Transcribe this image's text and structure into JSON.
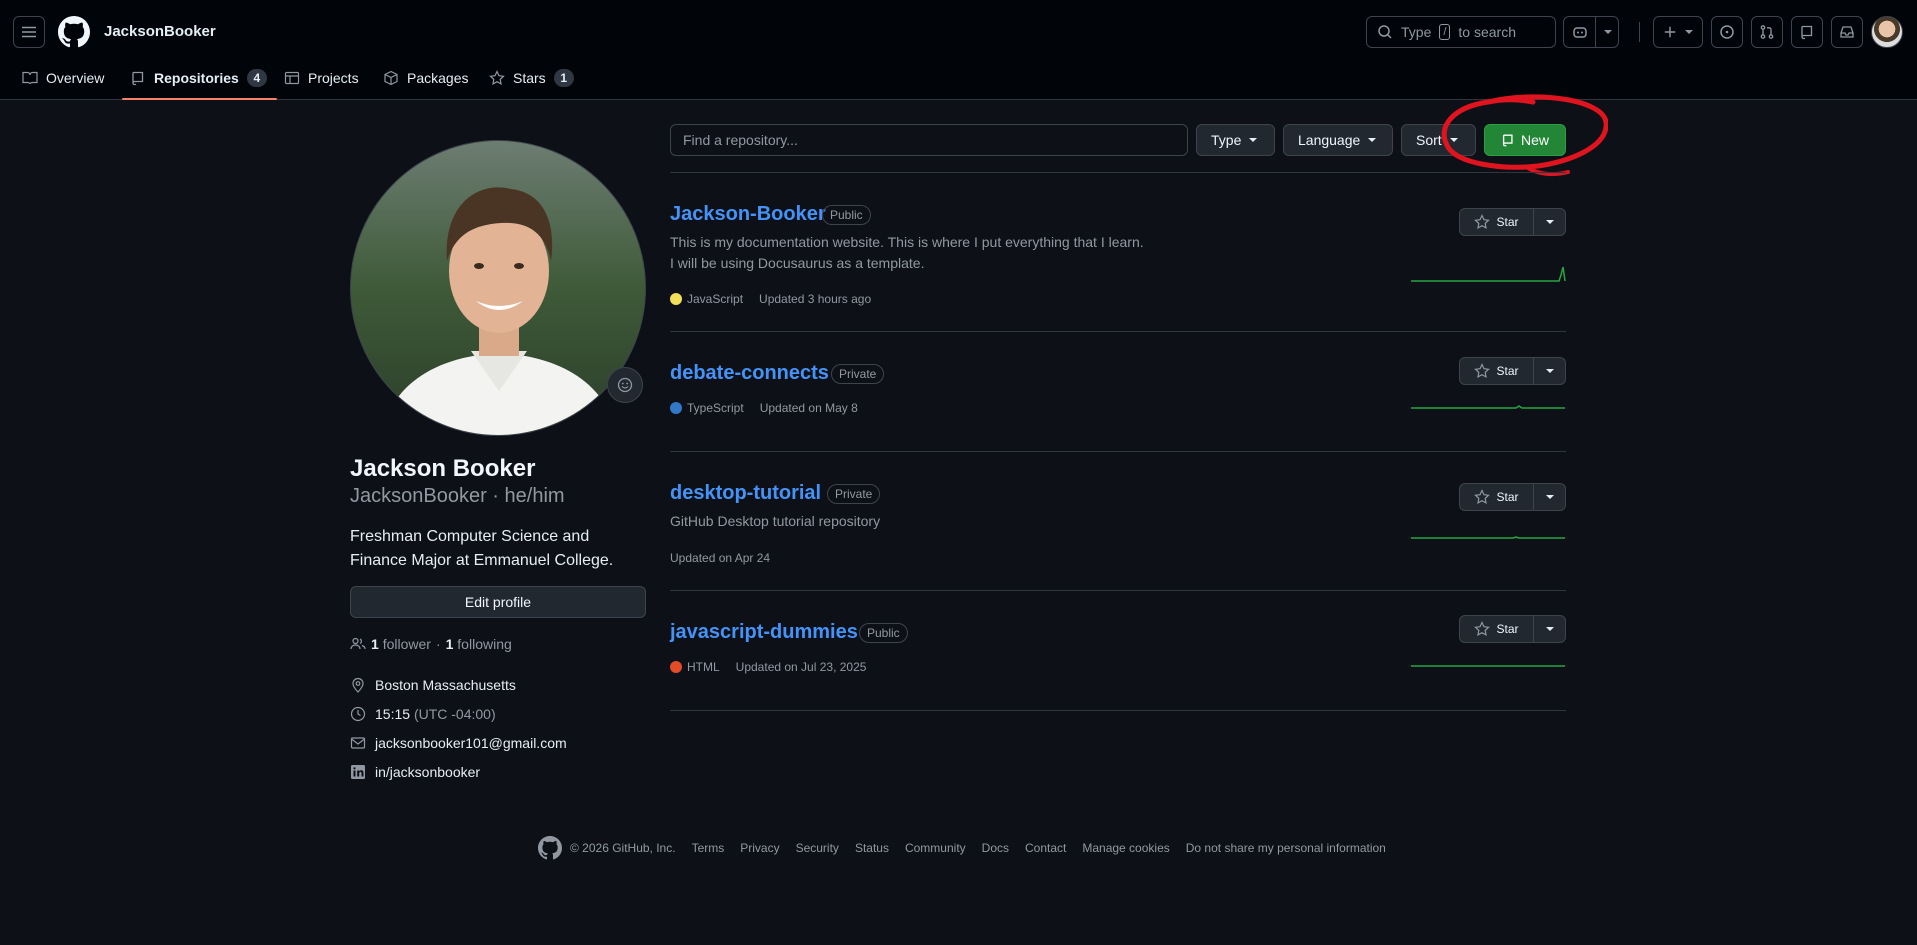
{
  "header": {
    "owner": "JacksonBooker",
    "search_text": "Type",
    "search_key": "/",
    "search_suffix": "to search"
  },
  "tabs": [
    {
      "label": "Overview"
    },
    {
      "label": "Repositories",
      "count": "4"
    },
    {
      "label": "Projects"
    },
    {
      "label": "Packages"
    },
    {
      "label": "Stars",
      "count": "1"
    }
  ],
  "profile": {
    "name": "Jackson Booker",
    "login_pronouns": "JacksonBooker · he/him",
    "bio": "Freshman Computer Science and Finance Major at Emmanuel College.",
    "edit_label": "Edit profile",
    "followers_count": "1",
    "followers_label": "follower",
    "dot": "·",
    "following_count": "1",
    "following_label": "following",
    "location": "Boston Massachusetts",
    "time": "15:15",
    "timezone": "(UTC -04:00)",
    "email": "jacksonbooker101@gmail.com",
    "linkedin": "in/jacksonbooker"
  },
  "filters": {
    "find_placeholder": "Find a repository...",
    "type_label": "Type",
    "language_label": "Language",
    "sort_label": "Sort",
    "new_label": "New"
  },
  "repos": [
    {
      "name": "Jackson-Booker",
      "visibility": "Public",
      "description": "This is my documentation website. This is where I put everything that I learn. I will be using Docusaurus as a template.",
      "language": "JavaScript",
      "lang_color": "#f1e05a",
      "updated": "Updated 3 hours ago",
      "star_label": "Star"
    },
    {
      "name": "debate-connects",
      "visibility": "Private",
      "description": "",
      "language": "TypeScript",
      "lang_color": "#3178c6",
      "updated": "Updated on May 8",
      "star_label": "Star"
    },
    {
      "name": "desktop-tutorial",
      "visibility": "Private",
      "description": "GitHub Desktop tutorial repository",
      "language": "",
      "lang_color": "",
      "updated": "Updated on Apr 24",
      "star_label": "Star"
    },
    {
      "name": "javascript-dummies",
      "visibility": "Public",
      "description": "",
      "language": "HTML",
      "lang_color": "#e34c26",
      "updated": "Updated on Jul 23, 2025",
      "star_label": "Star"
    }
  ],
  "footer": {
    "copyright": "© 2026 GitHub, Inc.",
    "links": [
      "Terms",
      "Privacy",
      "Security",
      "Status",
      "Community",
      "Docs",
      "Contact",
      "Manage cookies",
      "Do not share my personal information"
    ]
  },
  "colors": {
    "accent": "#4493f8",
    "new_button": "#238636",
    "annotation": "#e0141e",
    "tab_underline": "#f78166"
  }
}
